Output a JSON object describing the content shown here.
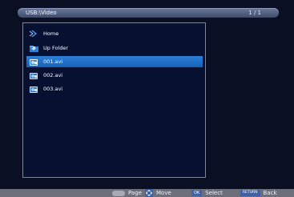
{
  "header": {
    "path": "USB:\\Video",
    "page_counter": "1 / 1"
  },
  "file_list": {
    "items": [
      {
        "label": "Home",
        "icon": "home-icon"
      },
      {
        "label": "Up Folder",
        "icon": "up-folder-icon"
      },
      {
        "label": "001.avi",
        "icon": "video-file-icon",
        "selected": true
      },
      {
        "label": "002.avi",
        "icon": "video-file-icon"
      },
      {
        "label": "003.avi",
        "icon": "video-file-icon"
      }
    ]
  },
  "footer": {
    "page_label": "Page",
    "move_label": "Move",
    "select_key": "OK",
    "select_label": "Select",
    "back_key": "RETURN",
    "back_label": "Back"
  },
  "colors": {
    "background": "#0a0f24",
    "selection": "#2b7fd8",
    "footer_bar": "#6c6f7a"
  }
}
